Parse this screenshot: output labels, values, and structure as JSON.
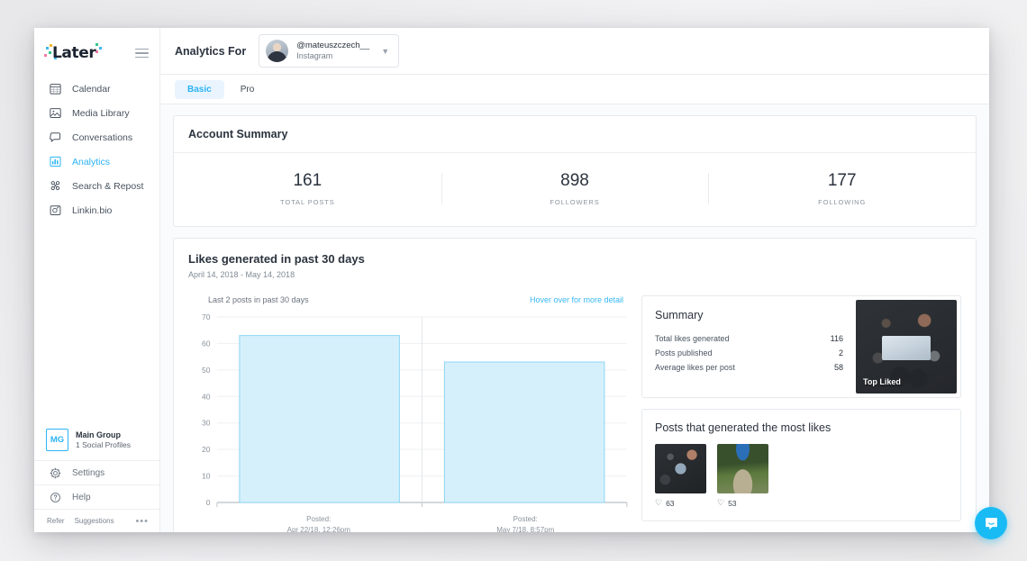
{
  "sidebar": {
    "logo_text": "Later",
    "logo_dot_colors": [
      "#3fb6f0",
      "#34c38f",
      "#f27ba6",
      "#f7b731",
      "#7a5cf0"
    ],
    "menu_icon": "hamburger-icon",
    "items": [
      {
        "label": "Calendar",
        "icon": "calendar-icon",
        "active": false
      },
      {
        "label": "Media Library",
        "icon": "image-icon",
        "active": false
      },
      {
        "label": "Conversations",
        "icon": "chat-bubble-icon",
        "active": false
      },
      {
        "label": "Analytics",
        "icon": "bar-chart-icon",
        "active": true
      },
      {
        "label": "Search & Repost",
        "icon": "network-icon",
        "active": false
      },
      {
        "label": "Linkin.bio",
        "icon": "camera-link-icon",
        "active": false
      }
    ],
    "group": {
      "badge": "MG",
      "name": "Main Group",
      "sub": "1 Social Profiles"
    },
    "links": [
      {
        "label": "Settings",
        "icon": "gear-icon"
      },
      {
        "label": "Help",
        "icon": "question-circle-icon"
      }
    ],
    "footer": {
      "refer": "Refer",
      "suggestions": "Suggestions",
      "more": "•••"
    },
    "accent_color": "#2bb3f3"
  },
  "topbar": {
    "title": "Analytics For",
    "account": {
      "handle": "@mateuszczech__",
      "platform": "Instagram"
    },
    "chevron": "chevron-down-icon"
  },
  "tabs": [
    {
      "label": "Basic",
      "active": true
    },
    {
      "label": "Pro",
      "active": false
    }
  ],
  "account_summary": {
    "title": "Account Summary",
    "stats": [
      {
        "value": "161",
        "label": "TOTAL POSTS"
      },
      {
        "value": "898",
        "label": "FOLLOWERS"
      },
      {
        "value": "177",
        "label": "FOLLOWING"
      }
    ]
  },
  "likes_section": {
    "title": "Likes generated in past 30 days",
    "date_range": "April 14, 2018 - May 14, 2018",
    "chart_note": "Last 2 posts in past 30 days",
    "hover_link": "Hover over for more detail",
    "summary": {
      "title": "Summary",
      "rows": [
        {
          "label": "Total likes generated",
          "value": "116"
        },
        {
          "label": "Posts published",
          "value": "2"
        },
        {
          "label": "Average likes per post",
          "value": "58"
        }
      ],
      "top_liked_caption": "Top Liked"
    },
    "posts_panel": {
      "title": "Posts that generated the most likes",
      "posts": [
        {
          "likes": "63",
          "thumb": "dark"
        },
        {
          "likes": "53",
          "thumb": "nature"
        }
      ]
    }
  },
  "chart_data": {
    "type": "bar",
    "title": "Likes generated in past 30 days",
    "subtitle": "April 14, 2018 - May 14, 2018",
    "categories": [
      "Posted:\nApr 22/18, 12:26pm",
      "Posted:\nMay 7/18, 8:57pm"
    ],
    "category_lines": [
      [
        "Posted:",
        "Apr 22/18, 12:26pm"
      ],
      [
        "Posted:",
        "May 7/18, 8:57pm"
      ]
    ],
    "values": [
      63,
      53
    ],
    "xlabel": "",
    "ylabel": "",
    "ylim": [
      0,
      70
    ],
    "yticks": [
      0,
      10,
      20,
      30,
      40,
      50,
      60,
      70
    ],
    "grid": true,
    "legend": false,
    "bar_fill": "#d6f0fb",
    "bar_stroke": "#8ed7f4"
  },
  "intercom": {
    "icon": "chat-smile-icon",
    "color": "#19bbf5"
  }
}
